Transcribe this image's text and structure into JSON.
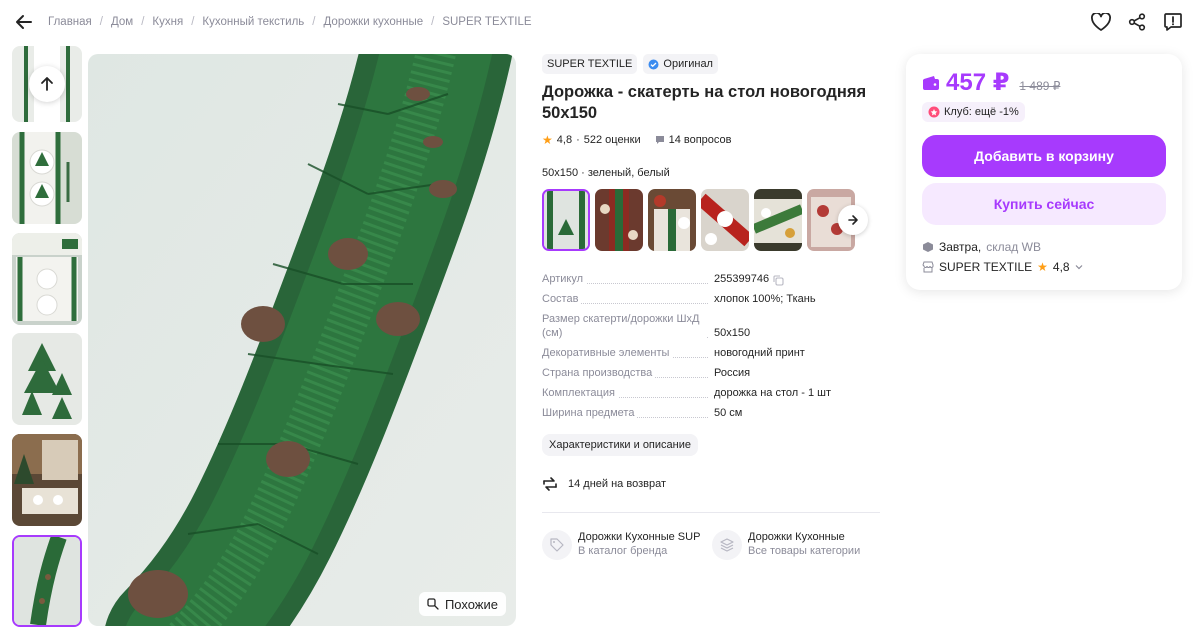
{
  "breadcrumbs": [
    "Главная",
    "Дом",
    "Кухня",
    "Кухонный текстиль",
    "Дорожки кухонные",
    "SUPER TEXTILE"
  ],
  "product": {
    "brand": "SUPER TEXTILE",
    "original_label": "Оригинал",
    "title": "Дорожка - скатерть на стол новогодняя 50x150",
    "rating": "4,8",
    "reviews": "522 оценки",
    "questions": "14 вопросов",
    "variant_label": "50x150 · зеленый, белый",
    "similar_label": "Похожие"
  },
  "specs": [
    {
      "key": "Артикул",
      "value": "255399746"
    },
    {
      "key": "Состав",
      "value": "хлопок 100%; Ткань"
    },
    {
      "key": "Размер скатерти/дорожки ШхД (см)",
      "value": "50x150"
    },
    {
      "key": "Декоративные элементы",
      "value": "новогодний принт"
    },
    {
      "key": "Страна производства",
      "value": "Россия"
    },
    {
      "key": "Комплектация",
      "value": "дорожка на стол - 1 шт"
    },
    {
      "key": "Ширина предмета",
      "value": "50 см"
    }
  ],
  "description_chip": "Характеристики и описание",
  "returns": "14 дней на возврат",
  "links": [
    {
      "title": "Дорожки Кухонные SUPER TEXTILE",
      "subtitle": "В каталог бренда"
    },
    {
      "title": "Дорожки Кухонные",
      "subtitle": "Все товары категории"
    }
  ],
  "price_card": {
    "price": "457 ₽",
    "old_price": "1 489 ₽",
    "club": "Клуб: ещё -1%",
    "add_to_cart": "Добавить в корзину",
    "buy_now": "Купить сейчас",
    "delivery_day": "Завтра,",
    "warehouse": "склад WB",
    "seller": "SUPER TEXTILE",
    "seller_rating": "4,8"
  },
  "colors": {
    "accent": "#a73afd",
    "accent_light": "#f6e9ff",
    "star": "#ff9e16"
  }
}
